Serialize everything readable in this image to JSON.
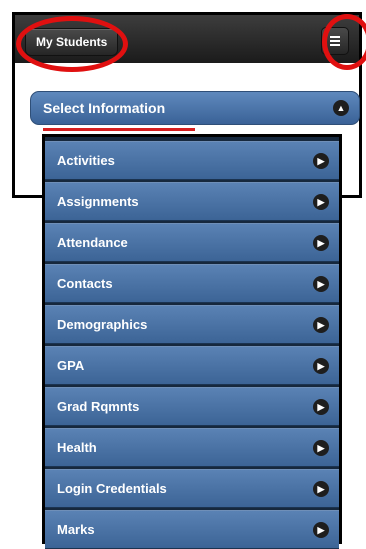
{
  "header": {
    "my_students_label": "My Students",
    "menu_icon": "hamburger-menu-icon"
  },
  "select_information": {
    "label": "Select Information",
    "icon": "chevron-up-icon",
    "chevron_glyph": "▲"
  },
  "menu": {
    "item_icon": "chevron-right-icon",
    "chevron_glyph": "▶",
    "items": [
      {
        "label": "Activities"
      },
      {
        "label": "Assignments"
      },
      {
        "label": "Attendance"
      },
      {
        "label": "Contacts"
      },
      {
        "label": "Demographics"
      },
      {
        "label": "GPA"
      },
      {
        "label": "Grad Rqmnts"
      },
      {
        "label": "Health"
      },
      {
        "label": "Login Credentials"
      },
      {
        "label": "Marks"
      }
    ]
  },
  "colors": {
    "header_bg": "#2a2a2a",
    "item_blue": "#4a73a6",
    "annotation_red": "#e01010"
  }
}
